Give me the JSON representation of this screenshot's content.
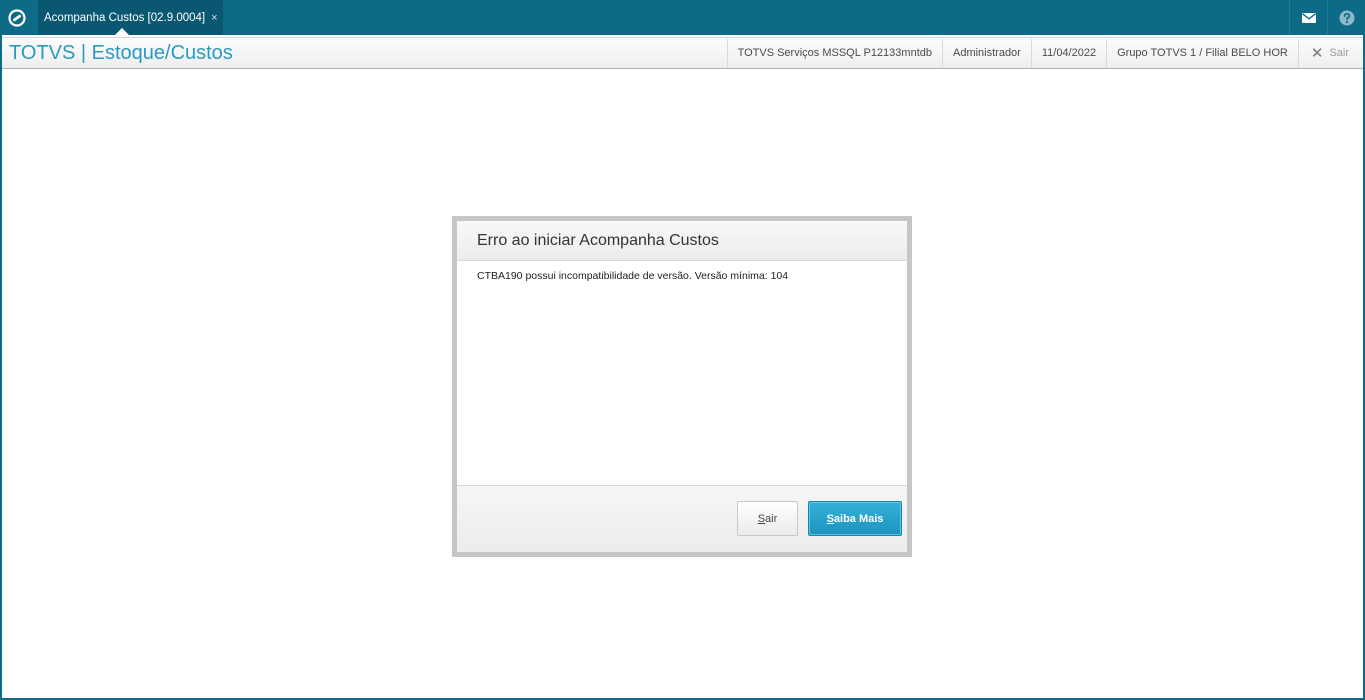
{
  "topbar": {
    "logo_icon": "totvs-logo-icon",
    "tab": {
      "label": "Acompanha Custos [02.9.0004]",
      "close_glyph": "×"
    },
    "icons": [
      "mail-icon",
      "help-icon"
    ]
  },
  "header": {
    "title": "TOTVS | Estoque/Custos",
    "environment": "TOTVS Serviços MSSQL P12133mntdb",
    "user": "Administrador",
    "date": "11/04/2022",
    "branch": "Grupo TOTVS 1 / Filial BELO HOR",
    "exit_label": "Sair"
  },
  "dialog": {
    "title": "Erro ao iniciar Acompanha Custos",
    "message": "CTBA190 possui incompatibilidade de versão. Versão mínima: 104",
    "buttons": {
      "exit_accesskey": "S",
      "exit_rest": "air",
      "learn_accesskey": "S",
      "learn_rest": "aiba Mais"
    }
  },
  "colors": {
    "topbar": "#0e6b88",
    "title": "#2a9ac2",
    "primary_button": "#1e94bd"
  }
}
